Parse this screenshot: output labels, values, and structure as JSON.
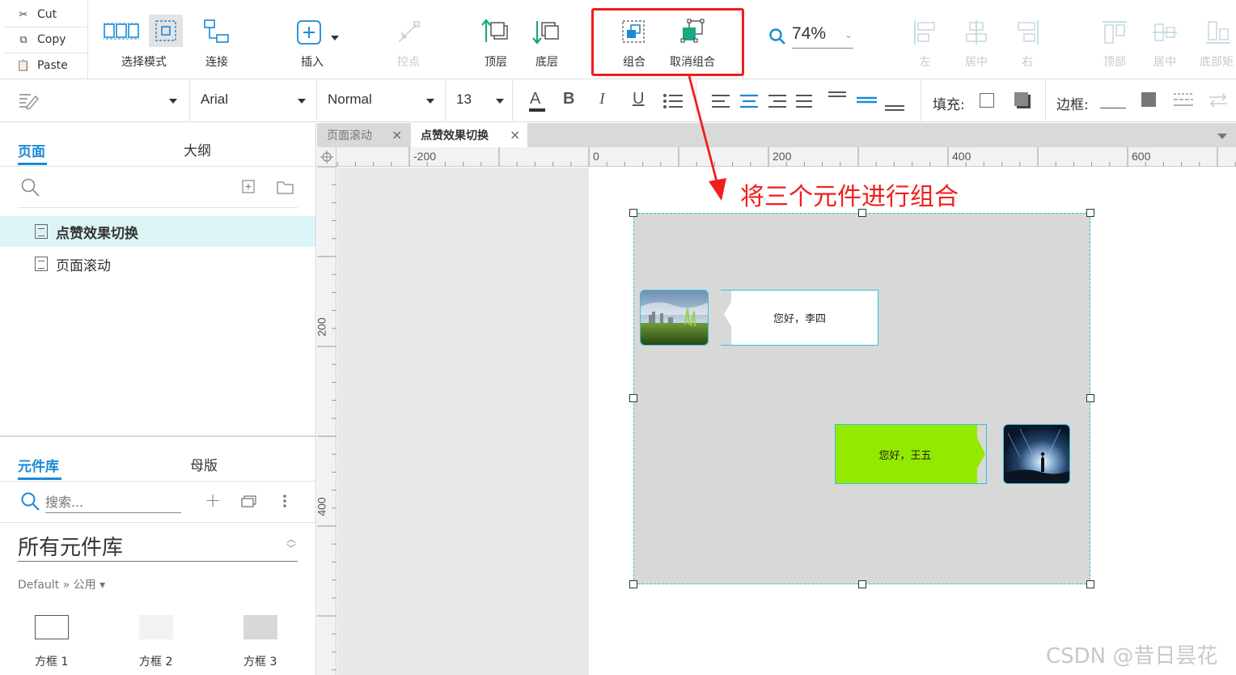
{
  "clipboard": {
    "cut": "Cut",
    "copy": "Copy",
    "paste": "Paste"
  },
  "toolbar": {
    "select_mode": "选择模式",
    "connect": "连接",
    "insert": "插入",
    "control_point": "控点",
    "top_layer": "顶层",
    "bottom_layer": "底层",
    "group": "组合",
    "ungroup": "取消组合",
    "zoom": "74%",
    "align_left": "左",
    "align_center": "居中",
    "align_right": "右",
    "align_top": "顶部",
    "align_middle": "居中",
    "align_bottom": "底部矩"
  },
  "format": {
    "font": "Arial",
    "style": "Normal",
    "size": "13",
    "fill_label": "填充:",
    "border_label": "边框:"
  },
  "pages_panel": {
    "tab_pages": "页面",
    "tab_outline": "大纲",
    "pages": [
      "点赞效果切换",
      "页面滚动"
    ]
  },
  "library_panel": {
    "tab_library": "元件库",
    "tab_masters": "母版",
    "search_placeholder": "搜索...",
    "library_name": "所有元件库",
    "breadcrumb": "Default » 公用 ▾",
    "widgets": [
      "方框 1",
      "方框 2",
      "方框 3"
    ]
  },
  "doc_tabs": [
    "页面滚动",
    "点赞效果切换"
  ],
  "ruler": {
    "top": [
      "-200",
      "0",
      "200",
      "400",
      "600"
    ],
    "left": [
      "200",
      "400"
    ]
  },
  "canvas": {
    "bubble_1": "您好，李四",
    "bubble_2": "您好，王五"
  },
  "annotation": "将三个元件进行组合",
  "watermark": "CSDN @昔日昙花",
  "colors": {
    "accent": "#1a8ad4",
    "highlight": "#f01e1e",
    "selection": "#31c4d4",
    "green_bubble": "#93ea00"
  }
}
